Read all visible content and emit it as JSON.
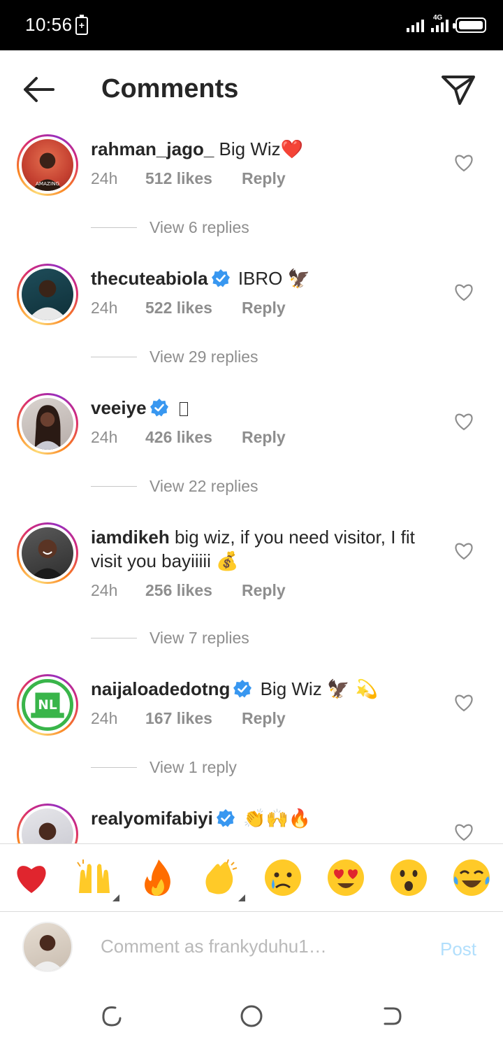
{
  "status_bar": {
    "time": "10:56",
    "network": "4G"
  },
  "header": {
    "title": "Comments",
    "back_icon": "arrow-left-icon",
    "share_icon": "paper-plane-icon"
  },
  "comments": [
    {
      "username": "rahman_jago_",
      "verified": false,
      "text": "Big Wiz",
      "emoji": "❤️",
      "time": "24h",
      "likes": "512 likes",
      "reply": "Reply",
      "view_replies": "View 6 replies"
    },
    {
      "username": "thecuteabiola",
      "verified": true,
      "text": "IBRO",
      "emoji": "🦅",
      "time": "24h",
      "likes": "522 likes",
      "reply": "Reply",
      "view_replies": "View 29 replies"
    },
    {
      "username": "veeiye",
      "verified": true,
      "text": "",
      "emoji": "",
      "time": "24h",
      "likes": "426 likes",
      "reply": "Reply",
      "view_replies": "View 22 replies"
    },
    {
      "username": "iamdikeh",
      "verified": false,
      "text": "big wiz, if you need visitor, I fit visit you bayiiiii",
      "emoji": "💰",
      "time": "24h",
      "likes": "256 likes",
      "reply": "Reply",
      "view_replies": "View 7 replies"
    },
    {
      "username": "naijaloadedotng",
      "verified": true,
      "text": "Big Wiz",
      "emoji": "🦅 💫",
      "time": "24h",
      "likes": "167 likes",
      "reply": "Reply",
      "view_replies": "View 1 reply"
    },
    {
      "username": "realyomifabiyi",
      "verified": true,
      "text": "",
      "emoji": "👏🙌🔥",
      "time": "",
      "likes": "",
      "reply": "",
      "view_replies": ""
    }
  ],
  "reactions": [
    "❤️",
    "🙌",
    "🔥",
    "👏",
    "😢",
    "😍",
    "😮",
    "😂"
  ],
  "composer": {
    "placeholder": "Comment as frankyduhu1…",
    "post_label": "Post"
  },
  "colors": {
    "accent_blue": "#b2dffc",
    "verified_blue": "#3897f0",
    "muted_text": "#8e8e8e",
    "primary_text": "#262626"
  }
}
